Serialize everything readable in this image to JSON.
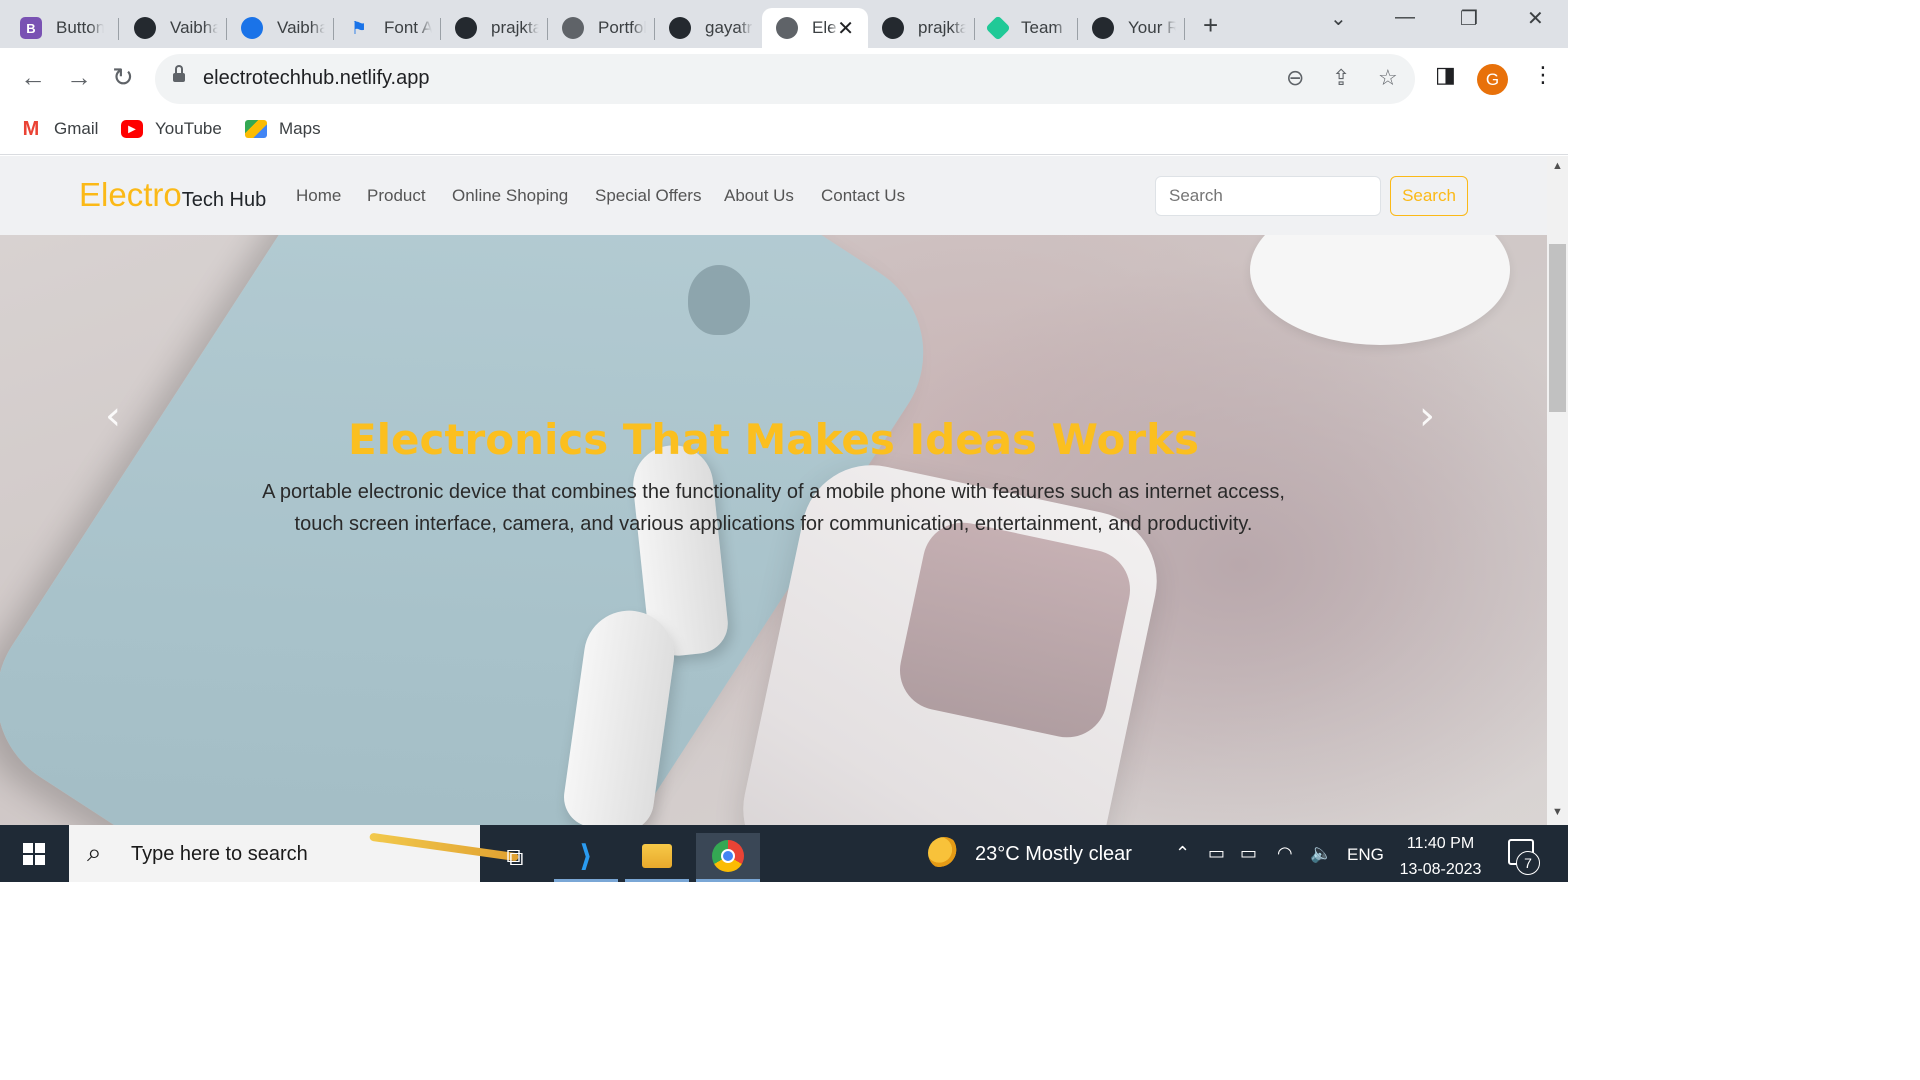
{
  "browser": {
    "tabs": [
      {
        "title": "Button",
        "icon": "bootstrap-icon"
      },
      {
        "title": "Vaibha",
        "icon": "github-icon"
      },
      {
        "title": "Vaibha",
        "icon": "user-icon"
      },
      {
        "title": "Font A",
        "icon": "flag-icon"
      },
      {
        "title": "prajkta",
        "icon": "github-icon"
      },
      {
        "title": "Portfol",
        "icon": "globe-icon"
      },
      {
        "title": "gayatr",
        "icon": "github-icon"
      },
      {
        "title": "Ele",
        "icon": "globe-icon",
        "active": true
      },
      {
        "title": "prajkta",
        "icon": "github-icon"
      },
      {
        "title": "Team",
        "icon": "diamond-icon"
      },
      {
        "title": "Your R",
        "icon": "github-icon"
      }
    ],
    "new_tab": "+",
    "url": "electrotechhub.netlify.app",
    "profile_initial": "G",
    "bookmarks": [
      {
        "label": "Gmail",
        "icon": "gmail-icon"
      },
      {
        "label": "YouTube",
        "icon": "youtube-icon"
      },
      {
        "label": "Maps",
        "icon": "maps-icon"
      }
    ]
  },
  "site": {
    "brand_part1": "Electro",
    "brand_part2": "Tech Hub",
    "nav": [
      "Home",
      "Product",
      "Online Shoping",
      "Special Offers",
      "About Us",
      "Contact Us"
    ],
    "search_placeholder": "Search",
    "search_button": "Search",
    "hero": {
      "title": "Electronics That Makes Ideas Works",
      "text": "A portable electronic device that combines the functionality of a mobile phone with features such as internet access, touch screen interface, camera, and various applications for communication, entertainment, and productivity."
    },
    "colors": {
      "accent": "#fbb917",
      "navbar_bg": "#f0f1f3"
    }
  },
  "taskbar": {
    "search_placeholder": "Type here to search",
    "weather": "23°C  Mostly clear",
    "language": "ENG",
    "time": "11:40 PM",
    "date": "13-08-2023",
    "notification_count": "7"
  }
}
